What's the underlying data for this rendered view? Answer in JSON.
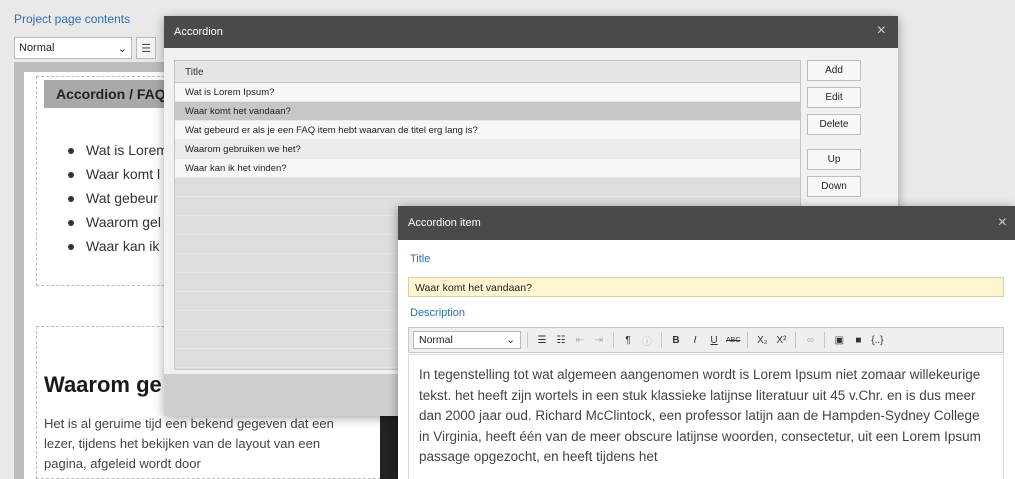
{
  "page": {
    "label": "Project page contents"
  },
  "bg_editor": {
    "format_select": "Normal",
    "faq_title": "Accordion / FAQ",
    "faq_items": [
      "Wat is Lorem",
      "Waar komt l",
      "Wat gebeur",
      "Waarom gel",
      "Waar kan ik"
    ],
    "section_title": "Waarom ge",
    "section_body": "Het is al geruime tijd een bekend gegeven dat een lezer, tijdens het bekijken van de layout van een pagina, afgeleid wordt door"
  },
  "accordion_dialog": {
    "title": "Accordion",
    "close_icon": "×",
    "column_header": "Title",
    "rows": [
      "Wat is Lorem Ipsum?",
      "Waar komt het vandaan?",
      "Wat gebeurd er als je een FAQ item hebt waarvan de titel erg lang is?",
      "Waarom gebruiken we het?",
      "Waar kan ik het vinden?"
    ],
    "selected_row": "Waar komt het vandaan?",
    "buttons": {
      "add": "Add",
      "edit": "Edit",
      "delete": "Delete",
      "up": "Up",
      "down": "Down"
    }
  },
  "item_dialog": {
    "title": "Accordion item",
    "close_icon": "×",
    "title_label": "Title",
    "title_value": "Waar komt het vandaan?",
    "description_label": "Description",
    "format_select": "Normal",
    "toolbar": {
      "bold": "B",
      "italic": "I",
      "underline": "U",
      "strike": "ABC",
      "subscript": "X₂",
      "superscript": "X²",
      "code": "{..}"
    },
    "description_text": "In tegenstelling tot wat algemeen aangenomen wordt is Lorem Ipsum niet zomaar willekeurige tekst. het heeft zijn wortels in een stuk klassieke latijnse literatuur uit 45 v.Chr. en is dus meer dan 2000 jaar oud. Richard McClintock, een professor latijn aan de Hampden-Sydney College in Virginia, heeft één van de meer obscure latijnse woorden, consectetur, uit een Lorem Ipsum passage opgezocht, en heeft tijdens het"
  },
  "icons": {
    "close": "close-icon",
    "dropdown": "chevron-down-icon",
    "bullet_list": "bulleted-list-icon",
    "numbered_list": "numbered-list-icon",
    "outdent": "outdent-icon",
    "indent": "indent-icon",
    "paragraph": "paragraph-icon",
    "info": "info-icon",
    "link": "link-icon",
    "image": "image-icon",
    "video": "video-icon"
  }
}
